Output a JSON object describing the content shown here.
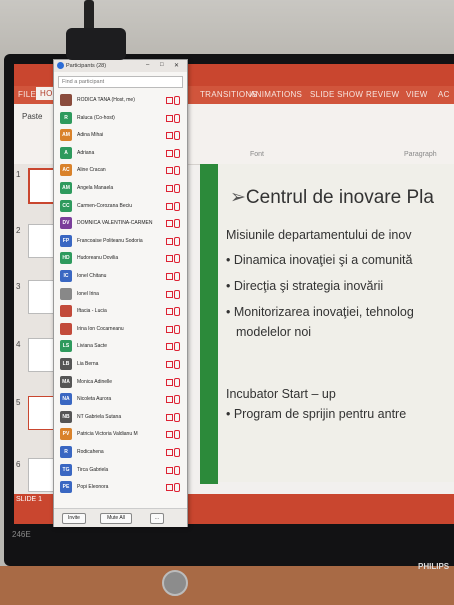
{
  "monitor": {
    "brand": "PHILIPS",
    "model": "246E"
  },
  "panel": {
    "title": "Participants (28)",
    "search_placeholder": "Find a participant",
    "participants": [
      {
        "initials": "",
        "name": "RODICA TANA (Host, me)",
        "color": "#8a4b3c"
      },
      {
        "initials": "R",
        "name": "Raluca (Co-host)",
        "color": "#2e9a5d"
      },
      {
        "initials": "AM",
        "name": "Adina Mihai",
        "color": "#d9822b"
      },
      {
        "initials": "A",
        "name": "Adriana",
        "color": "#2e9a5d"
      },
      {
        "initials": "AC",
        "name": "Aline Cracan",
        "color": "#d9822b"
      },
      {
        "initials": "AM",
        "name": "Angela Manaela",
        "color": "#2e9a5d"
      },
      {
        "initials": "CC",
        "name": "Carmen-Corozana Beciu",
        "color": "#2e9a5d"
      },
      {
        "initials": "DV",
        "name": "DOMNICA VALENTINA-CARMEN",
        "color": "#7a3d9a"
      },
      {
        "initials": "FP",
        "name": "Francoaise Politeanu Sodoria",
        "color": "#3a67c2"
      },
      {
        "initials": "HD",
        "name": "Hudoreanu Dovilia",
        "color": "#2e9a5d"
      },
      {
        "initials": "IC",
        "name": "Ionel Chitanu",
        "color": "#3a67c2"
      },
      {
        "initials": "",
        "name": "Ionel Irina",
        "color": "#888888"
      },
      {
        "initials": "",
        "name": "Iftacia - Lucia",
        "color": "#c24a3a"
      },
      {
        "initials": "",
        "name": "Irina Ion Cocarneanu",
        "color": "#c24a3a"
      },
      {
        "initials": "LS",
        "name": "Liviana Sacte",
        "color": "#2e9a5d"
      },
      {
        "initials": "LB",
        "name": "Lia Berna",
        "color": "#555555"
      },
      {
        "initials": "MA",
        "name": "Monica Adinelle",
        "color": "#555555"
      },
      {
        "initials": "NA",
        "name": "Nicoleta Aurora",
        "color": "#3a67c2"
      },
      {
        "initials": "NB",
        "name": "NT Gabriela Sutana",
        "color": "#555555"
      },
      {
        "initials": "PV",
        "name": "Patricia Victoria Valdianu M",
        "color": "#d9822b"
      },
      {
        "initials": "R",
        "name": "Rodicahena",
        "color": "#3a67c2"
      },
      {
        "initials": "TG",
        "name": "Tirca Gabriela",
        "color": "#3a67c2"
      },
      {
        "initials": "PE",
        "name": "Popi Eleonora",
        "color": "#3a67c2"
      }
    ],
    "invite_label": "Invite",
    "mute_all_label": "Mute All",
    "more_label": "..."
  },
  "ppt": {
    "tabs": [
      "FILE",
      "HOME",
      "TRANSITIONS",
      "ANIMATIONS",
      "SLIDE SHOW",
      "REVIEW",
      "VIEW",
      "AC"
    ],
    "paste_label": "Paste",
    "font_group": "Font",
    "paragraph_group": "Paragraph",
    "status_label": "SLIDE 1",
    "thumb_numbers": [
      "1",
      "2",
      "3",
      "4",
      "5",
      "6"
    ]
  },
  "slide": {
    "title": "Centrul de inovare Pla",
    "subtitle": "Misiunile departamentului de inov",
    "bullets": [
      "• Dinamica inovaţiei şi a comunită",
      "• Direcţia şi strategia inovării",
      "• Monitorizarea inovaţiei, tehnolog",
      "  modelelor noi"
    ],
    "section": "Incubator Start – up",
    "section_bullet": "• Program de sprijin pentru antre"
  }
}
